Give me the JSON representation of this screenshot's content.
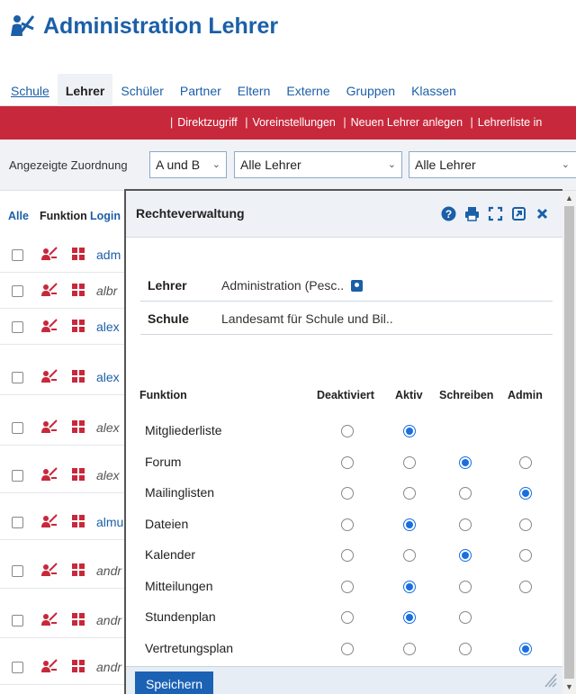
{
  "title": "Administration Lehrer",
  "nav": {
    "tabs": [
      {
        "label": "Schule",
        "active": false
      },
      {
        "label": "Lehrer",
        "active": true
      },
      {
        "label": "Schüler",
        "active": false
      },
      {
        "label": "Partner",
        "active": false
      },
      {
        "label": "Eltern",
        "active": false
      },
      {
        "label": "Externe",
        "active": false
      },
      {
        "label": "Gruppen",
        "active": false
      },
      {
        "label": "Klassen",
        "active": false
      }
    ]
  },
  "toolbar": {
    "links": [
      "Direktzugriff",
      "Voreinstellungen",
      "Neuen Lehrer anlegen",
      "Lehrerliste in"
    ]
  },
  "filter": {
    "label": "Angezeigte Zuordnung",
    "select1": "A und B",
    "select2": "Alle Lehrer",
    "select3": "Alle Lehrer"
  },
  "table": {
    "headers": {
      "all": "Alle",
      "function": "Funktion",
      "login": "Login"
    },
    "rows": [
      {
        "login": "adm",
        "italic": false
      },
      {
        "login": "albr",
        "italic": true
      },
      {
        "login": "alex",
        "italic": false
      },
      {
        "login": "alex",
        "italic": false
      },
      {
        "login": "alex",
        "italic": true
      },
      {
        "login": "alex",
        "italic": true
      },
      {
        "login": "almu",
        "italic": false
      },
      {
        "login": "andr",
        "italic": true
      },
      {
        "login": "andr",
        "italic": true
      },
      {
        "login": "andr",
        "italic": true
      }
    ]
  },
  "dialog": {
    "title": "Rechteverwaltung",
    "teacher_label": "Lehrer",
    "teacher_value": "Administration (Pesc..",
    "school_label": "Schule",
    "school_value": "Landesamt für Schule und Bil..",
    "columns": {
      "function": "Funktion",
      "deactivated": "Deaktiviert",
      "active": "Aktiv",
      "write": "Schreiben",
      "admin": "Admin"
    },
    "rights": [
      {
        "name": "Mitgliederliste",
        "options": [
          "Deaktiviert",
          "Aktiv"
        ],
        "selected": "Aktiv"
      },
      {
        "name": "Forum",
        "options": [
          "Deaktiviert",
          "Aktiv",
          "Schreiben",
          "Admin"
        ],
        "selected": "Schreiben"
      },
      {
        "name": "Mailinglisten",
        "options": [
          "Deaktiviert",
          "Aktiv",
          "Schreiben",
          "Admin"
        ],
        "selected": "Admin"
      },
      {
        "name": "Dateien",
        "options": [
          "Deaktiviert",
          "Aktiv",
          "Schreiben",
          "Admin"
        ],
        "selected": "Aktiv"
      },
      {
        "name": "Kalender",
        "options": [
          "Deaktiviert",
          "Aktiv",
          "Schreiben",
          "Admin"
        ],
        "selected": "Schreiben"
      },
      {
        "name": "Mitteilungen",
        "options": [
          "Deaktiviert",
          "Aktiv",
          "Schreiben",
          "Admin"
        ],
        "selected": "Aktiv"
      },
      {
        "name": "Stundenplan",
        "options": [
          "Deaktiviert",
          "Aktiv",
          "Schreiben"
        ],
        "selected": "Aktiv"
      },
      {
        "name": "Vertretungsplan",
        "options": [
          "Deaktiviert",
          "Aktiv",
          "Schreiben",
          "Admin"
        ],
        "selected": "Admin"
      }
    ],
    "save_label": "Speichern",
    "header_icons": [
      "help-icon",
      "print-icon",
      "fullscreen-icon",
      "external-link-icon",
      "close-icon"
    ]
  },
  "colors": {
    "brand_blue": "#1b5fa8",
    "toolbar_red": "#c8283b",
    "radio_blue": "#1a6fe0",
    "role_icon_red": "#c8283b"
  }
}
